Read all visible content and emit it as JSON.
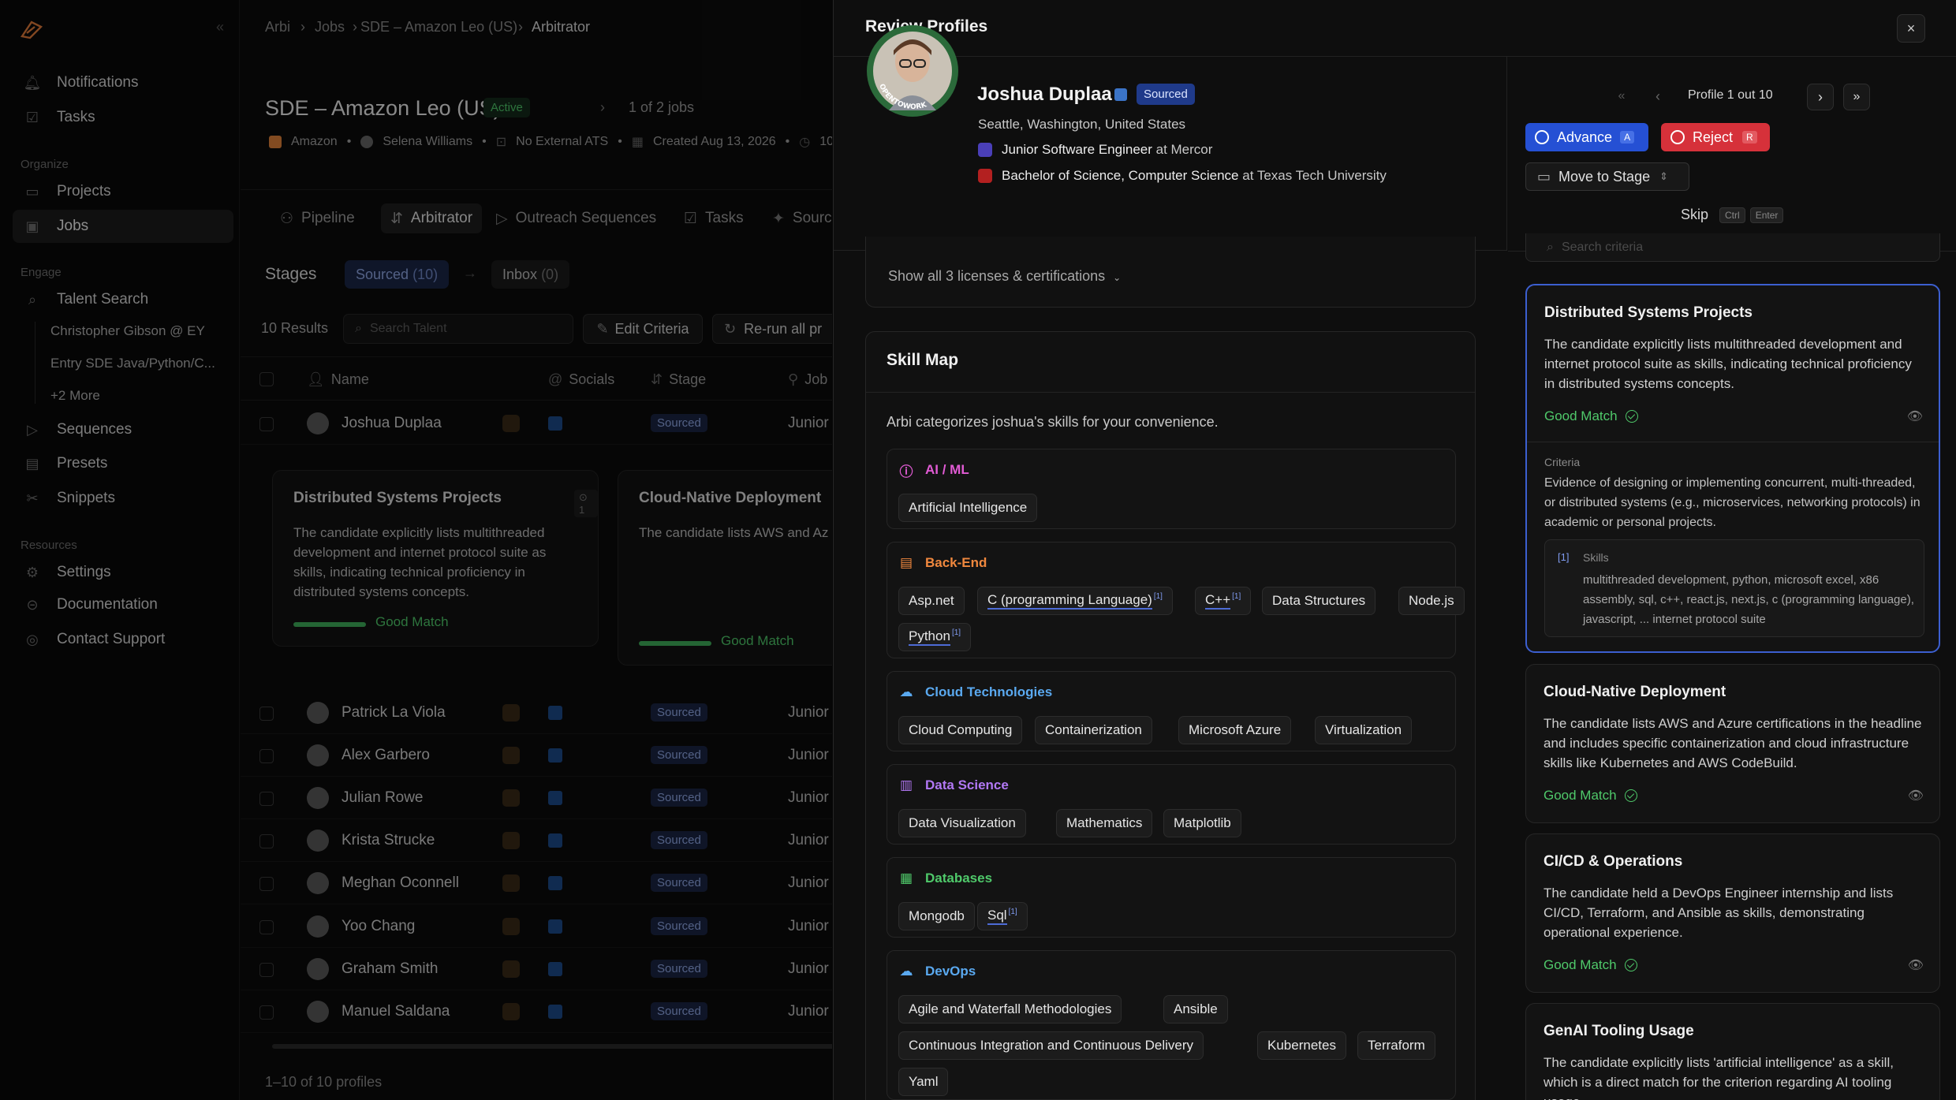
{
  "sidebar": {
    "collapse_icon": "chevrons-left-icon",
    "items_top": [
      {
        "label": "Notifications",
        "icon": "bell-icon"
      },
      {
        "label": "Tasks",
        "icon": "tasks-icon"
      }
    ],
    "organize_label": "Organize",
    "organize": [
      {
        "label": "Projects",
        "icon": "folder-icon"
      },
      {
        "label": "Jobs",
        "icon": "briefcase-icon"
      }
    ],
    "engage_label": "Engage",
    "talent_search": "Talent Search",
    "talent_subs": [
      "Christopher Gibson @ EY",
      "Entry SDE Java/Python/C...",
      "+2 More"
    ],
    "engage": [
      {
        "label": "Sequences",
        "icon": "send-icon"
      },
      {
        "label": "Presets",
        "icon": "preset-icon"
      },
      {
        "label": "Snippets",
        "icon": "scissors-icon"
      }
    ],
    "resources_label": "Resources",
    "resources": [
      {
        "label": "Settings",
        "icon": "gear-icon"
      },
      {
        "label": "Documentation",
        "icon": "book-icon"
      },
      {
        "label": "Contact Support",
        "icon": "support-icon"
      }
    ]
  },
  "main": {
    "breadcrumbs": [
      "Arbi",
      "Jobs",
      "SDE – Amazon Leo (US)",
      "Arbitrator"
    ],
    "job_title": "SDE – Amazon Leo (US)",
    "status": "Active",
    "job_count": "1 of 2 jobs",
    "meta": {
      "company": "Amazon",
      "owner": "Selena Williams",
      "ats": "No External ATS",
      "created": "Created Aug 13, 2026",
      "more": "10"
    },
    "tabs": [
      "Pipeline",
      "Arbitrator",
      "Outreach Sequences",
      "Tasks",
      "Sourc"
    ],
    "stages_label": "Stages",
    "stage_sourced": "Sourced",
    "stage_sourced_count": "(10)",
    "stage_inbox": "Inbox",
    "stage_inbox_count": "(0)",
    "results": "10 Results",
    "search_placeholder": "Search Talent",
    "edit_criteria": "Edit Criteria",
    "rerun": "Re-run all pr",
    "columns": [
      "Name",
      "Socials",
      "Stage",
      "Job"
    ],
    "status_badge": "Sourced",
    "job_cell": "Junior",
    "first_row": "Joshua Duplaa",
    "rows": [
      "Patrick La Viola",
      "Alex Garbero",
      "Julian Rowe",
      "Krista Strucke",
      "Meghan Oconnell",
      "Yoo Chang",
      "Graham Smith",
      "Manuel Saldana"
    ],
    "card1": {
      "title": "Distributed Systems Projects",
      "count": "1",
      "desc": "The candidate explicitly lists multithreaded development and internet protocol suite as skills, indicating technical proficiency in distributed systems concepts.",
      "match": "Good Match"
    },
    "card2": {
      "title": "Cloud-Native Deployment",
      "desc": "The candidate lists AWS and Azure certifications in the headline and includes specific containerization and cloud infrastructure skills like Kubernetes and AWS CodeBuild.",
      "match": "Good Match"
    },
    "footer": "1–10 of 10 profiles"
  },
  "panel": {
    "title": "Review Profiles",
    "close_icon": "close-icon",
    "avatar_ring_text": "OPENTOWORK",
    "name": "Joshua Duplaa",
    "stage_badge": "Sourced",
    "location": "Seattle, Washington, United States",
    "role": "Junior Software Engineer",
    "role_at": "at Mercor",
    "education": "Bachelor of Science, Computer Science",
    "education_at": "at Texas Tech University",
    "profile_counter": "Profile 1 out 10",
    "advance": "Advance",
    "advance_key": "A",
    "reject": "Reject",
    "reject_key": "R",
    "move_stage": "Move to Stage",
    "skip": "Skip",
    "skip_keys": [
      "Ctrl",
      "Enter"
    ],
    "show_licenses": "Show all 3 licenses & certifications",
    "search_criteria_placeholder": "Search criteria",
    "skill_map": {
      "title": "Skill Map",
      "subtitle": "Arbi categorizes joshua's skills for your convenience.",
      "categories": [
        {
          "name": "AI / ML",
          "color": "#e15bd4",
          "icon": "info-icon",
          "skills": [
            "Artificial Intelligence"
          ]
        },
        {
          "name": "Back-End",
          "color": "#f0883e",
          "icon": "server-icon",
          "skills": [
            "Asp.net",
            "C (programming Language)",
            "C++",
            "Data Structures",
            "Node.js",
            "Python"
          ]
        },
        {
          "name": "Cloud Technologies",
          "color": "#5aa9f0",
          "icon": "cloud-icon",
          "skills": [
            "Cloud Computing",
            "Containerization",
            "Microsoft Azure",
            "Virtualization"
          ]
        },
        {
          "name": "Data Science",
          "color": "#b278f5",
          "icon": "chart-icon",
          "skills": [
            "Data Visualization",
            "Mathematics",
            "Matplotlib"
          ]
        },
        {
          "name": "Databases",
          "color": "#4fc96a",
          "icon": "database-icon",
          "skills": [
            "Mongodb",
            "Sql"
          ]
        },
        {
          "name": "DevOps",
          "color": "#5aa9f0",
          "icon": "devops-icon",
          "skills": [
            "Agile and Waterfall Methodologies",
            "Ansible",
            "Continuous Integration and Continuous Delivery",
            "Kubernetes",
            "Terraform",
            "Yaml"
          ]
        }
      ],
      "superscript": "[1]"
    },
    "criteria_cards": [
      {
        "title": "Distributed Systems Projects",
        "desc": "The candidate explicitly lists multithreaded development and internet protocol suite as skills, indicating technical proficiency in distributed systems concepts.",
        "match": "Good Match",
        "criteria_label": "Criteria",
        "criteria": "Evidence of designing or implementing concurrent, multi-threaded, or distributed systems (e.g., microservices, networking protocols) in academic or personal projects.",
        "ref": "[1]",
        "ref_label": "Skills",
        "ref_text": "multithreaded development, python, microsoft excel, x86 assembly, sql, c++, react.js, next.js, c (programming language), javascript, ... internet protocol suite"
      },
      {
        "title": "Cloud-Native Deployment",
        "desc": "The candidate lists AWS and Azure certifications in the headline and includes specific containerization and cloud infrastructure skills like Kubernetes and AWS CodeBuild.",
        "match": "Good Match"
      },
      {
        "title": "CI/CD & Operations",
        "desc": "The candidate held a DevOps Engineer internship and lists CI/CD, Terraform, and Ansible as skills, demonstrating operational experience.",
        "match": "Good Match"
      },
      {
        "title": "GenAI Tooling Usage",
        "desc": "The candidate explicitly lists 'artificial intelligence' as a skill, which is a direct match for the criterion regarding AI tooling usage."
      }
    ]
  }
}
